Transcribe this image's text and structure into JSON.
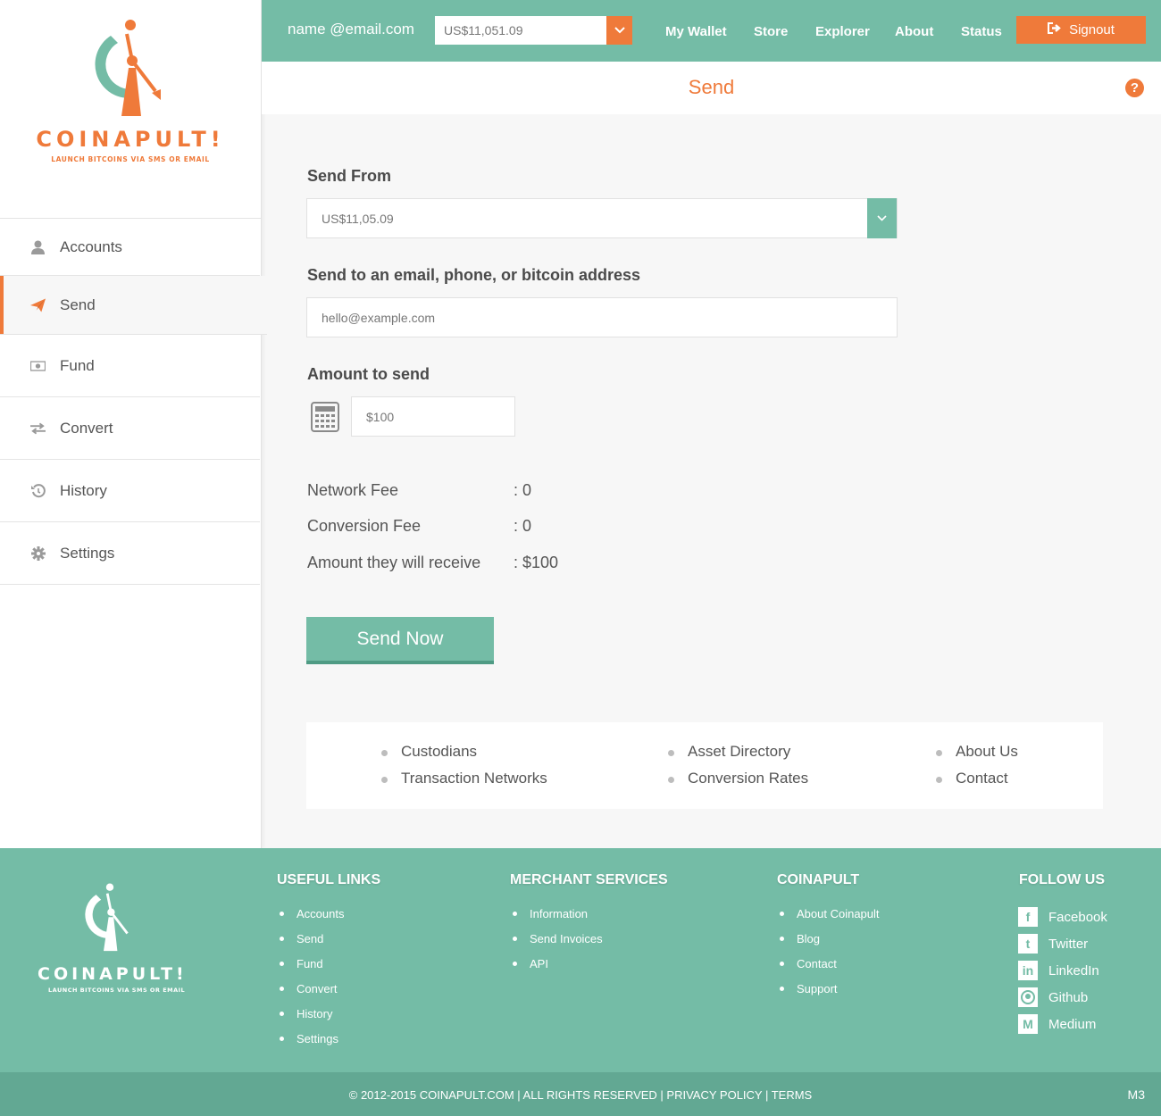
{
  "brand": {
    "name": "COINAPULT!",
    "tagline": "LAUNCH BITCOINS VIA SMS OR EMAIL",
    "accent": "#ef7a3a",
    "primary": "#74bca6"
  },
  "header": {
    "email": "name @email.com",
    "balance": "US$11,051.09",
    "nav": [
      "My Wallet",
      "Store",
      "Explorer",
      "About",
      "Status"
    ],
    "signout": "Signout"
  },
  "sidebar": {
    "items": [
      {
        "label": "Accounts",
        "icon": "user-icon"
      },
      {
        "label": "Send",
        "icon": "paper-plane-icon"
      },
      {
        "label": "Fund",
        "icon": "money-icon"
      },
      {
        "label": "Convert",
        "icon": "exchange-icon"
      },
      {
        "label": "History",
        "icon": "history-icon"
      },
      {
        "label": "Settings",
        "icon": "gear-icon"
      }
    ],
    "active": "Send"
  },
  "page": {
    "title": "Send",
    "send_from_label": "Send From",
    "send_from_value": "US$11,05.09",
    "send_to_label": "Send to an email, phone, or bitcoin address",
    "send_to_placeholder": "hello@example.com",
    "amount_label": "Amount to send",
    "amount_placeholder": "$100",
    "fees": [
      {
        "label": "Network Fee",
        "value": ": 0"
      },
      {
        "label": "Conversion Fee",
        "value": ": 0"
      },
      {
        "label": "Amount they will receive",
        "value": ": $100"
      }
    ],
    "send_button": "Send Now"
  },
  "links_panel": {
    "col1": [
      "Custodians",
      "Transaction Networks"
    ],
    "col2": [
      "Asset Directory",
      "Conversion Rates"
    ],
    "col3": [
      "About Us",
      "Contact"
    ]
  },
  "footer": {
    "useful_links": {
      "title": "USEFUL LINKS",
      "items": [
        "Accounts",
        "Send",
        "Fund",
        "Convert",
        "History",
        "Settings"
      ]
    },
    "merchant": {
      "title": "MERCHANT SERVICES",
      "items": [
        "Information",
        "Send Invoices",
        "API"
      ]
    },
    "coinapult": {
      "title": "COINAPULT",
      "items": [
        "About Coinapult",
        "Blog",
        "Contact",
        "Support"
      ]
    },
    "follow": {
      "title": "FOLLOW US",
      "items": [
        {
          "label": "Facebook",
          "icon": "facebook-icon"
        },
        {
          "label": "Twitter",
          "icon": "twitter-icon"
        },
        {
          "label": "LinkedIn",
          "icon": "linkedin-icon"
        },
        {
          "label": "Github",
          "icon": "github-icon"
        },
        {
          "label": "Medium",
          "icon": "medium-icon"
        }
      ]
    },
    "copyright": "© 2012-2015 COINAPULT.COM | ALL RIGHTS RESERVED | PRIVACY POLICY | TERMS",
    "version": "M3"
  }
}
